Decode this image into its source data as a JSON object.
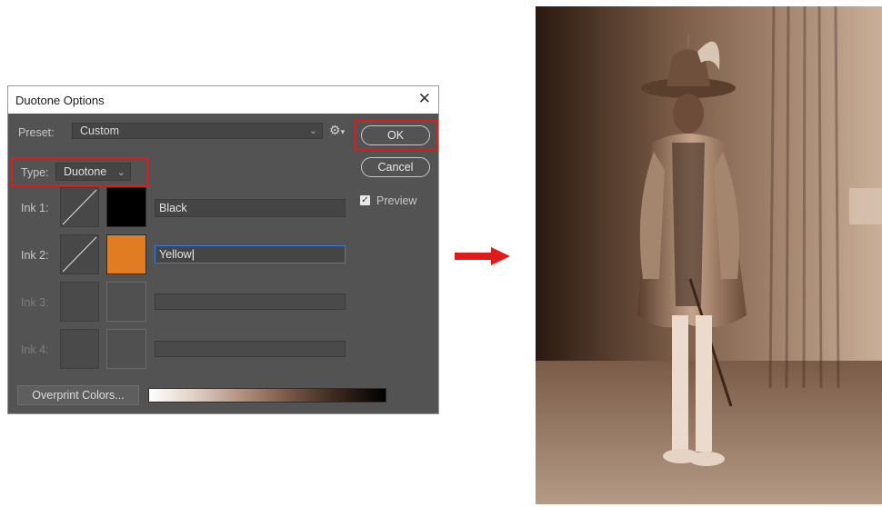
{
  "dialog": {
    "title": "Duotone Options",
    "close_glyph": "✕",
    "preset_label": "Preset:",
    "preset_value": "Custom",
    "gear_glyph": "⚙",
    "ok_label": "OK",
    "cancel_label": "Cancel",
    "type_label": "Type:",
    "type_value": "Duotone",
    "preview_label": "Preview",
    "preview_checked": true,
    "inks": [
      {
        "label": "Ink 1:",
        "name": "Black",
        "color": "#000000",
        "enabled": true
      },
      {
        "label": "Ink 2:",
        "name": "Yellow",
        "color": "#e07c22",
        "enabled": true
      },
      {
        "label": "Ink 3:",
        "name": "",
        "color": "",
        "enabled": false
      },
      {
        "label": "Ink 4:",
        "name": "",
        "color": "",
        "enabled": false
      }
    ],
    "overprint_label": "Overprint Colors...",
    "highlight_color": "#e01b1b"
  },
  "arrow_color": "#e01b1b",
  "icons": {
    "close": "close-icon",
    "gear": "gear-icon",
    "chevron": "chevron-down-icon",
    "check": "checkmark-icon",
    "arrow": "right-arrow-icon"
  }
}
